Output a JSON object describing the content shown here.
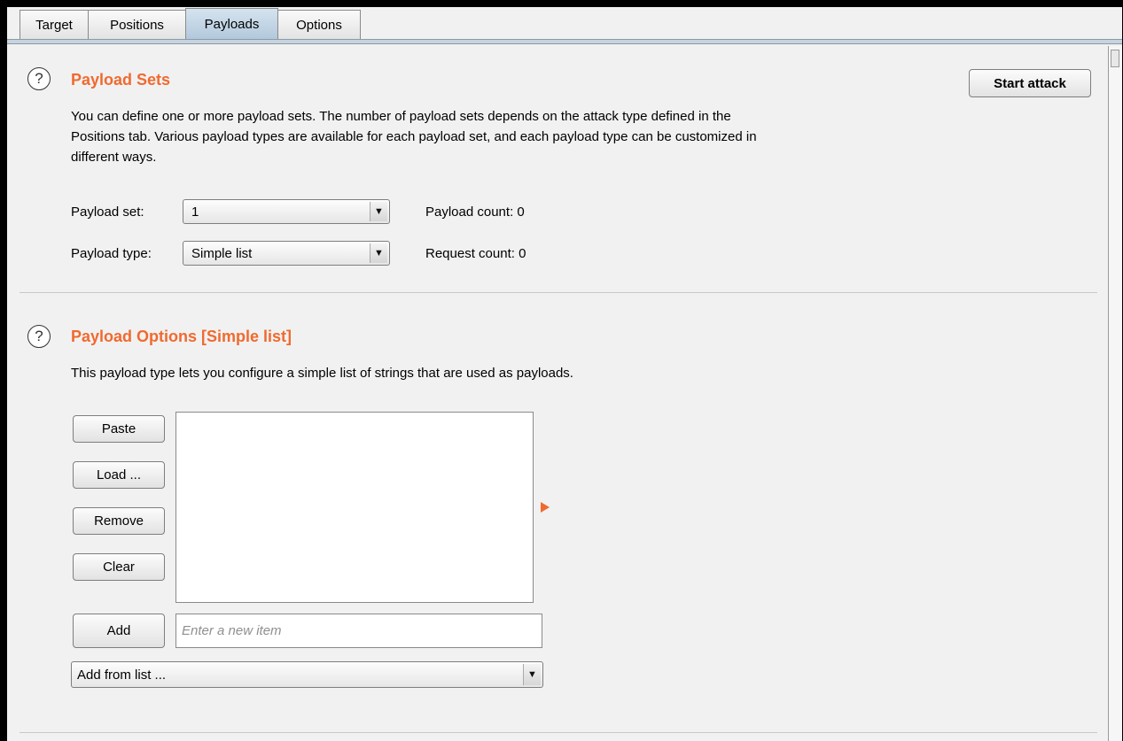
{
  "tabs": [
    {
      "label": "Target"
    },
    {
      "label": "Positions"
    },
    {
      "label": "Payloads"
    },
    {
      "label": "Options"
    }
  ],
  "active_tab": "Payloads",
  "payload_sets": {
    "help_glyph": "?",
    "title": "Payload Sets",
    "start_attack": "Start attack",
    "description_lines": [
      "You can define one or more payload sets. The number of payload sets depends on the attack type defined in the",
      "Positions tab. Various payload types are available for each payload set, and each payload type can be customized in",
      "different ways."
    ],
    "payload_set_label": "Payload set:",
    "payload_set_value": "1",
    "payload_type_label": "Payload type:",
    "payload_type_value": "Simple list",
    "payload_count": "Payload count:  0",
    "request_count": "Request count:  0"
  },
  "payload_options": {
    "help_glyph": "?",
    "title": "Payload Options [Simple list]",
    "description": "This payload type lets you configure a simple list of strings that are used as payloads.",
    "buttons": {
      "paste": "Paste",
      "load": "Load ...",
      "remove": "Remove",
      "clear": "Clear",
      "add": "Add"
    },
    "new_item_placeholder": "Enter a new item",
    "add_from_list": "Add from list ..."
  },
  "colors": {
    "heading": "#f06a2f",
    "active_tab": "#b2c9dc"
  }
}
